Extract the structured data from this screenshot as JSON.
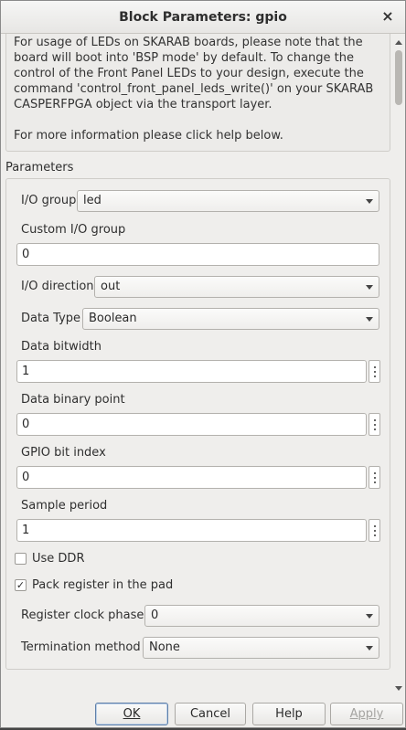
{
  "window": {
    "title": "Block Parameters: gpio",
    "close_glyph": "×"
  },
  "description": {
    "text": "For usage of LEDs on SKARAB boards, please note that the board will boot into 'BSP mode' by default. To change the control of the Front Panel LEDs to your design, execute the command 'control_front_panel_leds_write()' on your SKARAB CASPERFPGA object via the transport layer.\n\nFor more information please click help below."
  },
  "parameters": {
    "section_label": "Parameters",
    "io_group": {
      "label": "I/O group",
      "value": "led"
    },
    "custom_io_group": {
      "label": "Custom I/O group",
      "value": "0"
    },
    "io_direction": {
      "label": "I/O direction",
      "value": "out"
    },
    "data_type": {
      "label": "Data Type",
      "value": "Boolean"
    },
    "data_bitwidth": {
      "label": "Data bitwidth",
      "value": "1"
    },
    "data_binary_point": {
      "label": "Data binary point",
      "value": "0"
    },
    "gpio_bit_index": {
      "label": "GPIO bit index",
      "value": "0"
    },
    "sample_period": {
      "label": "Sample period",
      "value": "1"
    },
    "use_ddr": {
      "label": "Use DDR",
      "checked": false
    },
    "pack_register": {
      "label": "Pack register in the pad",
      "checked": true,
      "check_glyph": "✓"
    },
    "register_clock_phase": {
      "label": "Register clock phase",
      "value": "0"
    },
    "termination_method": {
      "label": "Termination method",
      "value": "None"
    }
  },
  "buttons": {
    "ok": {
      "label": "OK",
      "default": true
    },
    "cancel": {
      "label": "Cancel"
    },
    "help": {
      "label": "Help"
    },
    "apply": {
      "label": "Apply",
      "enabled": false
    }
  },
  "colors": {
    "window_bg": "#efeeec",
    "default_button_border": "#5e7fa8"
  }
}
